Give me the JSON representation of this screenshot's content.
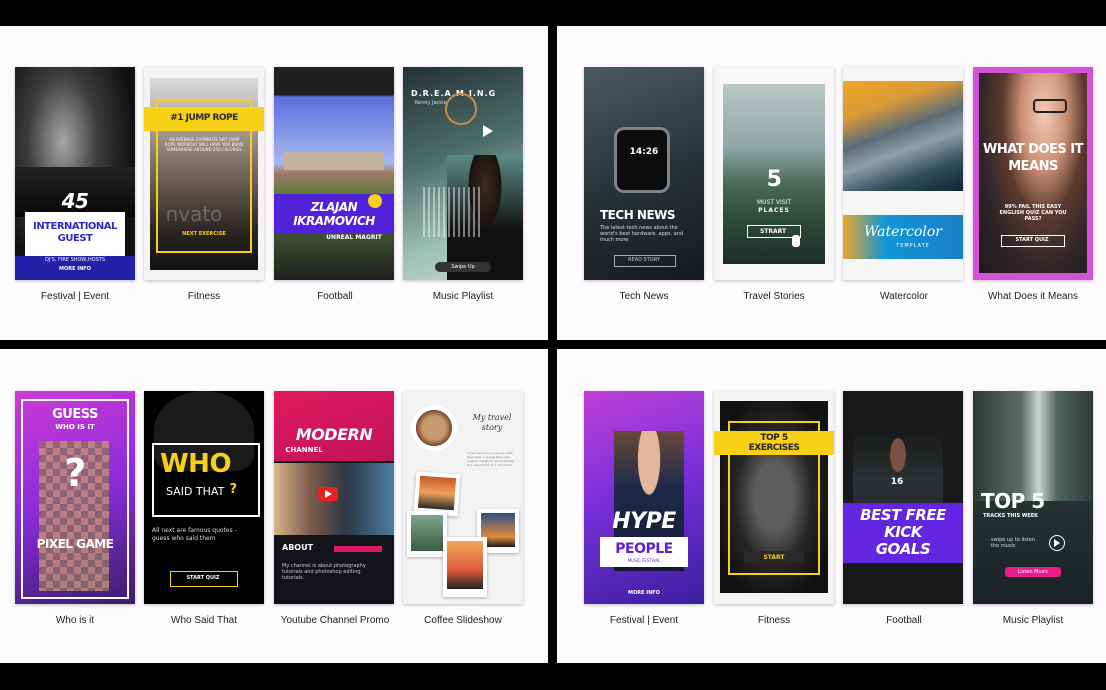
{
  "panels": {
    "top_left": {
      "captions": [
        "Festival | Event",
        "Fitness",
        "Football",
        "Music Playlist"
      ],
      "festival": {
        "number": "45",
        "title": "INTERNATIONAL GUEST",
        "subtitle": "DJ'S, FIRE SHOW,HOSTS",
        "cta": "MORE INFO"
      },
      "fitness": {
        "title": "#1 JUMP ROPE",
        "body": "AN AVERAGE 10-MINUTE SKIT JUMP ROPE WORKOUT WILL HAVE YOU BURN SOMEWHERE AROUND 250 CALORIES",
        "watermark": "nvato",
        "cta": "NEXT EXERCISE"
      },
      "football": {
        "title": "ZLAJAN IKRAMOVICH",
        "subtitle": "UNREAL MAGRIT"
      },
      "music": {
        "title": "D.R.E.A.M.I.N.G",
        "artist": "Kenny Jackie",
        "cta": "Swipe Up"
      }
    },
    "top_right": {
      "captions": [
        "Tech News",
        "Travel Stories",
        "Watercolor",
        "What Does it Means"
      ],
      "tech": {
        "time": "14:26",
        "title": "TECH NEWS",
        "body": "The latest tech news about the world's best hardware, apps, and much more",
        "cta": "READ STORY"
      },
      "travel": {
        "number": "5",
        "line1": "MUST VISIT",
        "line2": "PLACES",
        "cta": "STRART"
      },
      "watercolor": {
        "title": "Watercolor",
        "subtitle": "TEMPLATE"
      },
      "what": {
        "title": "WHAT DOES IT MEANS",
        "body": "99% FAIL THIS EASY ENGLISH QUIZ CAN YOU PASS?",
        "cta": "START QUIZ"
      }
    },
    "bottom_left": {
      "captions": [
        "Who is it",
        "Who Said That",
        "Youtube Channel Promo",
        "Coffee Slideshow"
      ],
      "who_is": {
        "line1": "GUESS",
        "line2": "WHO IS IT",
        "title": "PIXEL GAME"
      },
      "who_said": {
        "big": "WHO",
        "small": "SAID THAT",
        "q": "?",
        "body": "All next are famous quotes - guess who said them",
        "cta": "START QUIZ"
      },
      "youtube": {
        "title": "MODERN",
        "subtitle": "CHANNEL",
        "about": "ABOUT",
        "body": "My channel is about photography tutorials and photoshop editing tutorials."
      },
      "coffee": {
        "title": "My travel story",
        "body": "Lorem ipsum is a pseudo-Latin text used in typography and graphic design to demonstrate the visual form of a document"
      }
    },
    "bottom_right": {
      "captions": [
        "Festival | Event",
        "Fitness",
        "Football",
        "Music Playlist"
      ],
      "hype": {
        "title": "HYPE",
        "people": "PEOPLE",
        "sub": "MUSIC FESTIVAL",
        "cta": "MORE INFO"
      },
      "fitness": {
        "title": "TOP 5 EXERCISES",
        "cta": "START"
      },
      "football": {
        "title": "BEST FREE KICK GOALS",
        "number": "16"
      },
      "music": {
        "title": "TOP 5",
        "subtitle": "TRACKS THIS WEEK",
        "body": "swipe up to listen the music",
        "cta": "Listen Music"
      }
    }
  },
  "colors": {
    "panel": "#fdfbfe",
    "purple": "#5b21d6",
    "magenta": "#d03bd6",
    "yellow": "#f7d117",
    "pink": "#e0195e"
  }
}
